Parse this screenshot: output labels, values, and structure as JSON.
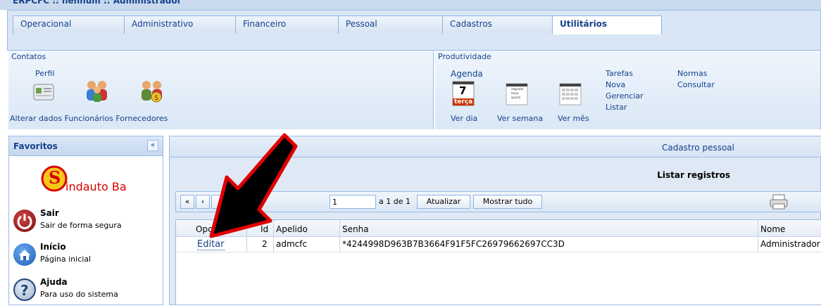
{
  "window": {
    "title": "ERPCFC :: nenhum :: Administrador"
  },
  "tabs": [
    {
      "label": "Operacional"
    },
    {
      "label": "Administrativo"
    },
    {
      "label": "Financeiro"
    },
    {
      "label": "Pessoal"
    },
    {
      "label": "Cadastros"
    },
    {
      "label": "Utilitários"
    }
  ],
  "ribbon": {
    "contatos": {
      "title": "Contatos",
      "perfil": "Perfil",
      "caption": "Alterar dados Funcionários Fornecedores"
    },
    "produtividade": {
      "title": "Produtividade",
      "agenda": "Agenda",
      "ver_dia": "Ver dia",
      "ver_semana": "Ver semana",
      "ver_mes": "Ver mês",
      "calendar_day": "7",
      "calendar_weekday": "terça",
      "week_lines": [
        "segunda",
        "terça",
        "quarta"
      ],
      "tarefas": {
        "title": "Tarefas",
        "items": [
          "Nova",
          "Gerenciar",
          "Listar"
        ]
      },
      "normas": {
        "title": "Normas",
        "items": [
          "Consultar"
        ]
      }
    }
  },
  "sidebar": {
    "title": "Favoritos",
    "collapse_label": "«",
    "logo_text": "indauto Ba",
    "logo_letter": "S",
    "items": [
      {
        "title": "Sair",
        "subtitle": "Sair de forma segura"
      },
      {
        "title": "Início",
        "subtitle": "Página inicial"
      },
      {
        "title": "Ajuda",
        "subtitle": "Para uso do sistema"
      }
    ]
  },
  "main": {
    "title": "Cadastro pessoal",
    "subtitle": "Listar registros",
    "pager": {
      "first": "«",
      "prev": "‹",
      "page_value": "1",
      "page_info": "a 1 de 1",
      "refresh": "Atualizar",
      "show_all": "Mostrar tudo"
    },
    "grid": {
      "columns": [
        "Opções",
        "Id",
        "Apelido",
        "Senha",
        "Nome"
      ],
      "rows": [
        {
          "option": "Editar",
          "id": "2",
          "apelido": "admcfc",
          "senha": "*4244998D963B7B3664F91F5FC26979662697CC3D",
          "nome": "Administrador"
        }
      ]
    }
  },
  "colors": {
    "accent": "#15428b",
    "border": "#99bbe8",
    "arrow": "#e00000"
  }
}
